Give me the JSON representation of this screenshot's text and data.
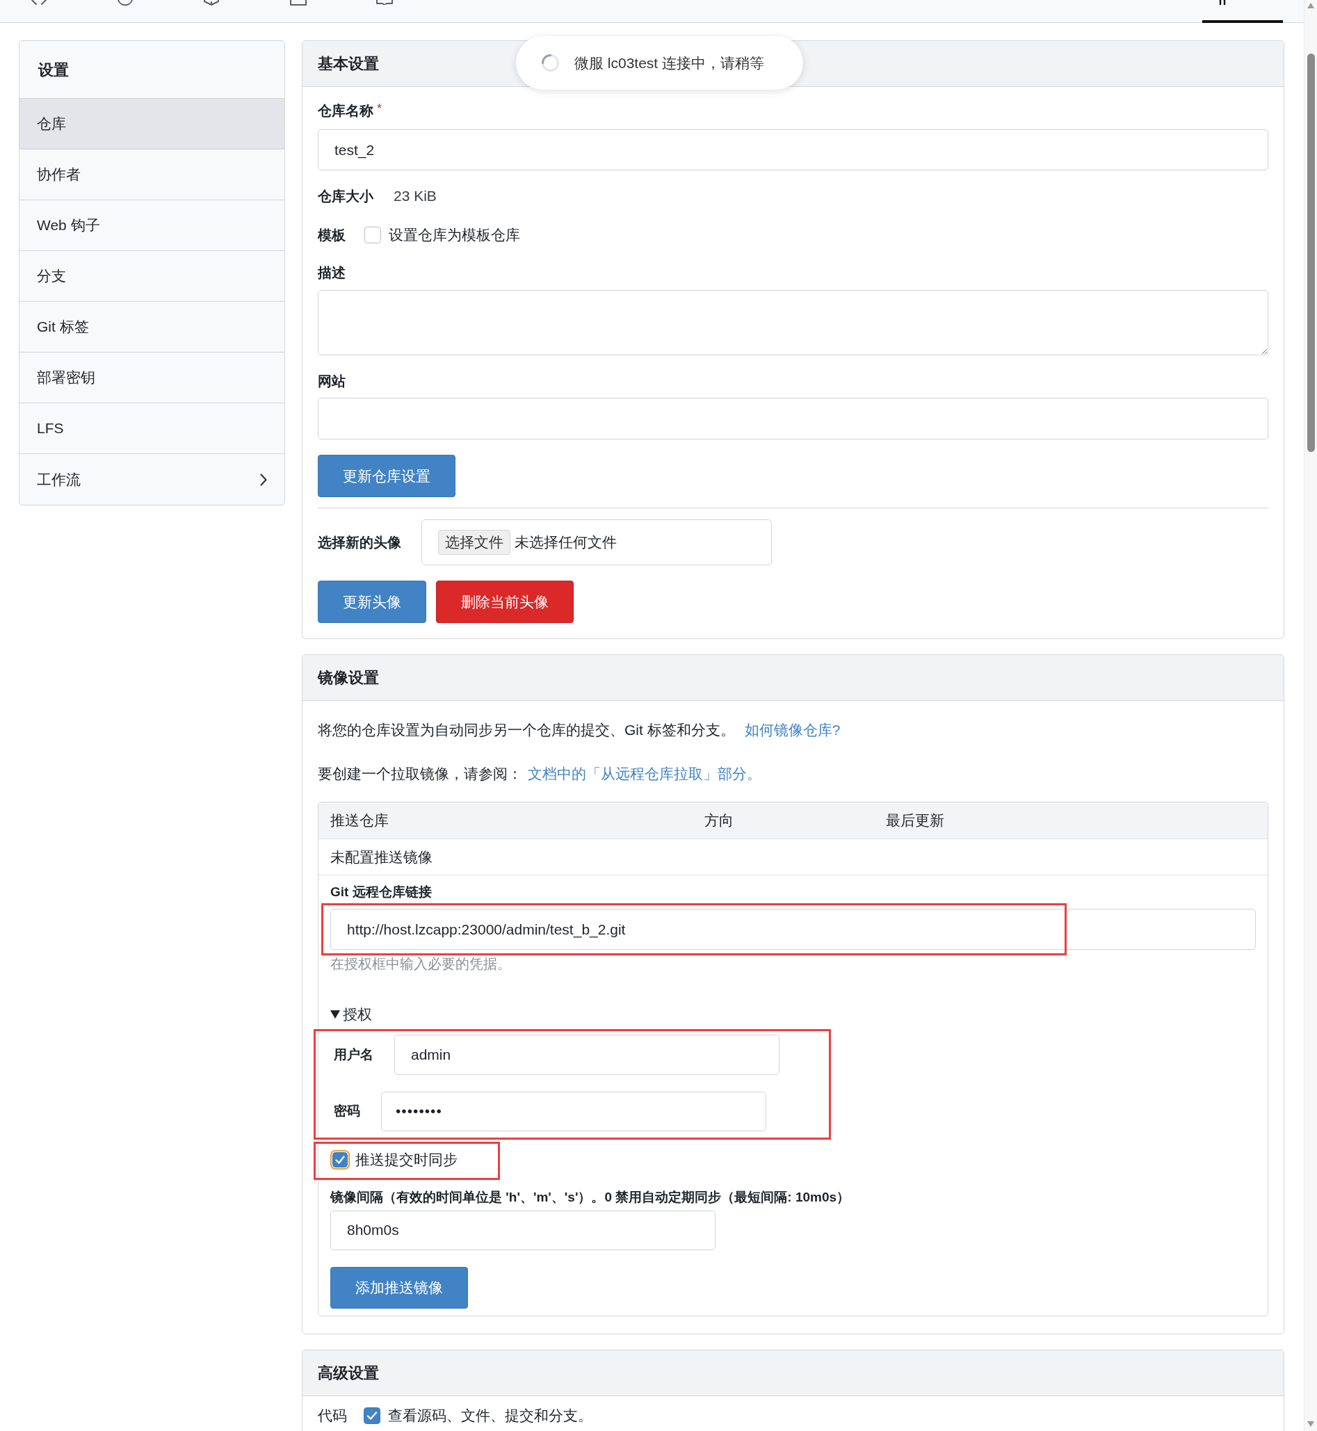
{
  "top_nav": {
    "tabs": [
      {
        "selected": false
      },
      {
        "selected": false
      },
      {
        "selected": false
      },
      {
        "selected": false
      },
      {
        "selected": false
      },
      {
        "selected": true
      }
    ]
  },
  "toast": {
    "text": "微服 lc03test 连接中，请稍等"
  },
  "sidebar": {
    "title": "设置",
    "items": [
      {
        "label": "仓库",
        "selected": true,
        "has_submenu": false
      },
      {
        "label": "协作者",
        "selected": false,
        "has_submenu": false
      },
      {
        "label": "Web 钩子",
        "selected": false,
        "has_submenu": false
      },
      {
        "label": "分支",
        "selected": false,
        "has_submenu": false
      },
      {
        "label": "Git 标签",
        "selected": false,
        "has_submenu": false
      },
      {
        "label": "部署密钥",
        "selected": false,
        "has_submenu": false
      },
      {
        "label": "LFS",
        "selected": false,
        "has_submenu": false
      },
      {
        "label": "工作流",
        "selected": false,
        "has_submenu": true
      }
    ]
  },
  "basic_settings": {
    "title": "基本设置",
    "repo_name": {
      "label": "仓库名称",
      "required_mark": "*",
      "value": "test_2"
    },
    "repo_size": {
      "label": "仓库大小",
      "value": "23 KiB"
    },
    "template": {
      "label": "模板",
      "option": "设置仓库为模板仓库",
      "checked": false
    },
    "description": {
      "label": "描述"
    },
    "website": {
      "label": "网站"
    },
    "update_button": "更新仓库设置",
    "avatar": {
      "label": "选择新的头像",
      "file_button": "选择文件",
      "file_status": "未选择任何文件"
    },
    "avatar_buttons": [
      {
        "label": "更新头像",
        "kind": "primary"
      },
      {
        "label": "删除当前头像",
        "kind": "danger"
      }
    ]
  },
  "mirror_settings": {
    "title": "镜像设置",
    "intro": {
      "text": "将您的仓库设置为自动同步另一个仓库的提交、Git 标签和分支。",
      "link": "如何镜像仓库?"
    },
    "pull_note": {
      "text": "要创建一个拉取镜像，请参阅：",
      "link": "文档中的「从远程仓库拉取」部分。"
    },
    "table": {
      "columns": [
        "推送仓库",
        "方向",
        "最后更新"
      ],
      "empty_text": "未配置推送镜像"
    },
    "remote": {
      "label": "Git 远程仓库链接",
      "value": "http://host.lzcapp:23000/admin/test_b_2.git",
      "help": "在授权框中输入必要的凭据。",
      "highlighted": true
    },
    "auth": {
      "summary": "授权",
      "expanded": true,
      "highlighted": true,
      "username_label": "用户名",
      "username": "admin",
      "password_label": "密码",
      "password": "••••••••"
    },
    "sync_on_commit": {
      "label": "推送提交时同步",
      "checked": true,
      "focused": true,
      "highlighted": true
    },
    "interval": {
      "label": "镜像间隔（有效的时间单位是 'h'、'm'、's'）。0 禁用自动定期同步（最短间隔: 10m0s）",
      "value": "8h0m0s"
    },
    "submit_button": "添加推送镜像"
  },
  "advanced_settings": {
    "title": "高级设置",
    "units": [
      {
        "label": "代码",
        "checked": true,
        "description": "查看源码、文件、提交和分支。"
      }
    ]
  }
}
